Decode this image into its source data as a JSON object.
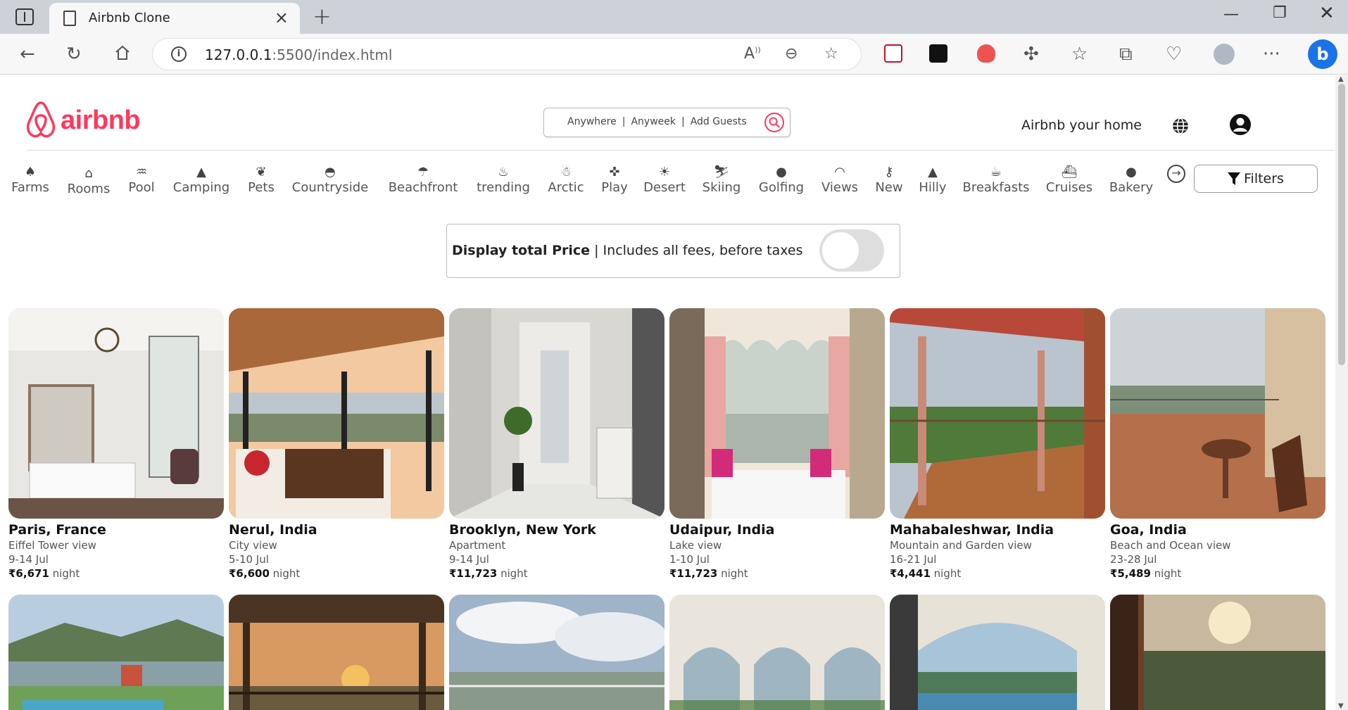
{
  "browser": {
    "tab_title": "Airbnb Clone",
    "url_host": "127.0.0.1",
    "url_rest": ":5500/index.html"
  },
  "header": {
    "logo_text": "airbnb",
    "search": {
      "where": "Anywhere",
      "when": "Anyweek",
      "who": "Add Guests"
    },
    "host_link": "Airbnb your home"
  },
  "categories": [
    {
      "label": "Farms",
      "icon": "farm-icon"
    },
    {
      "label": "Rooms",
      "icon": "house-icon"
    },
    {
      "label": "Pool",
      "icon": "pool-icon"
    },
    {
      "label": "Camping",
      "icon": "tent-icon"
    },
    {
      "label": "Pets",
      "icon": "cat-icon"
    },
    {
      "label": "Countryside",
      "icon": "hill-icon"
    },
    {
      "label": "Beachfront",
      "icon": "umbrella-icon"
    },
    {
      "label": "trending",
      "icon": "fire-icon"
    },
    {
      "label": "Arctic",
      "icon": "snowman-icon"
    },
    {
      "label": "Play",
      "icon": "gamepad-icon"
    },
    {
      "label": "Desert",
      "icon": "sun-icon"
    },
    {
      "label": "Skiing",
      "icon": "skier-icon"
    },
    {
      "label": "Golfing",
      "icon": "golf-icon"
    },
    {
      "label": "Views",
      "icon": "rainbow-icon"
    },
    {
      "label": "New",
      "icon": "key-icon"
    },
    {
      "label": "Hilly",
      "icon": "mountain-icon"
    },
    {
      "label": "Breakfasts",
      "icon": "mug-icon"
    },
    {
      "label": "Cruises",
      "icon": "ship-icon"
    },
    {
      "label": "Bakery",
      "icon": "cookie-icon"
    }
  ],
  "filters_label": "Filters",
  "price_toggle": {
    "bold": "Display total Price",
    "rest": " | Includes all fees, before taxes",
    "enabled": false
  },
  "listings": [
    {
      "name": "Paris, France",
      "desc": "Eiffel Tower view",
      "dates": "9-14 Jul",
      "price": "₹6,671",
      "unit": " night"
    },
    {
      "name": "Nerul, India",
      "desc": "City view",
      "dates": "5-10 Jul",
      "price": "₹6,600",
      "unit": " night"
    },
    {
      "name": "Brooklyn, New York",
      "desc": "Apartment",
      "dates": "9-14 Jul",
      "price": "₹11,723",
      "unit": " night"
    },
    {
      "name": "Udaipur, India",
      "desc": "Lake view",
      "dates": "1-10 Jul",
      "price": "₹11,723",
      "unit": " night"
    },
    {
      "name": "Mahabaleshwar, India",
      "desc": "Mountain and Garden view",
      "dates": "16-21 Jul",
      "price": "₹4,441",
      "unit": " night"
    },
    {
      "name": "Goa, India",
      "desc": "Beach and Ocean view",
      "dates": "23-28 Jul",
      "price": "₹5,489",
      "unit": " night"
    }
  ],
  "colors": {
    "brand": "#FF385C"
  }
}
